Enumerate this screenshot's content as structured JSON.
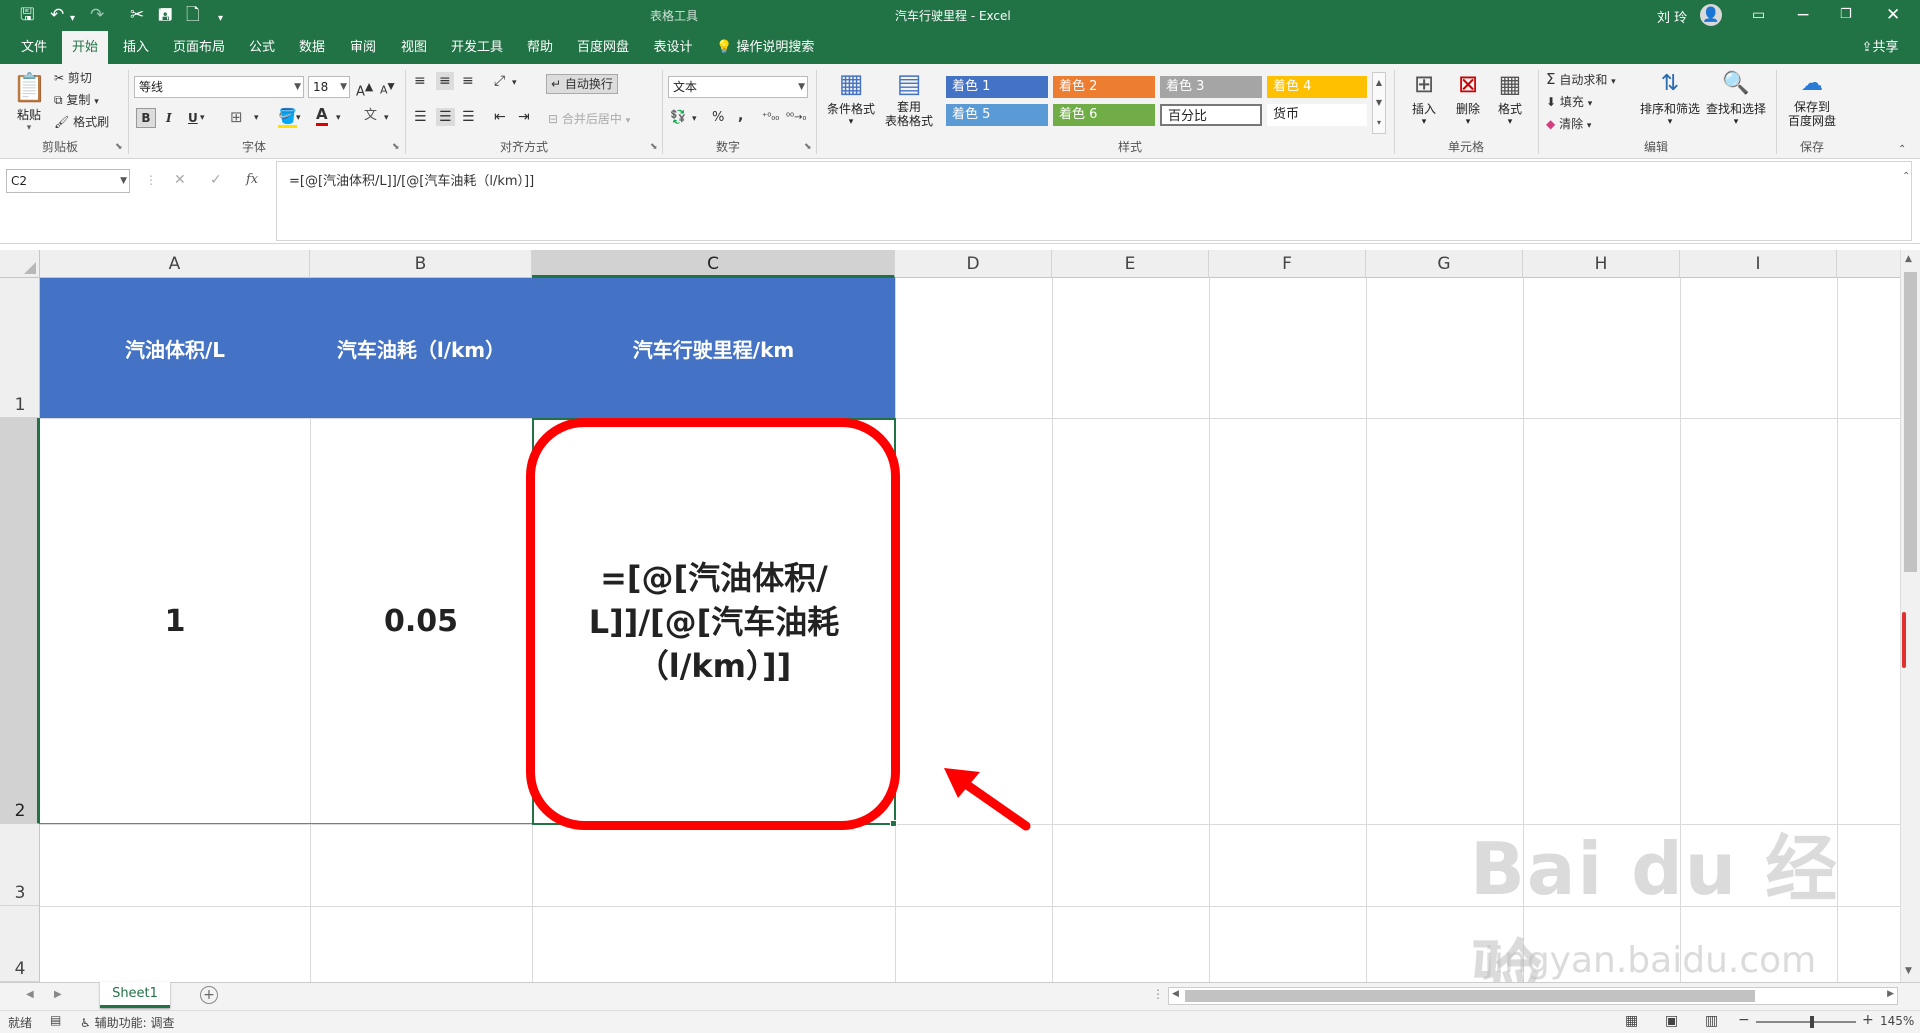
{
  "titlebar": {
    "context_tab": "表格工具",
    "title": "汽车行驶里程 - Excel",
    "user": "刘 玲",
    "qat_more": "▾"
  },
  "tabs": [
    "文件",
    "开始",
    "插入",
    "页面布局",
    "公式",
    "数据",
    "审阅",
    "视图",
    "开发工具",
    "帮助",
    "百度网盘",
    "表设计"
  ],
  "tell_me": "操作说明搜索",
  "share": "共享",
  "ribbon": {
    "clipboard": {
      "paste": "粘贴",
      "cut": "剪切",
      "copy": "复制",
      "painter": "格式刷",
      "label": "剪贴板"
    },
    "font": {
      "name": "等线",
      "size": "18",
      "bold": "B",
      "italic": "I",
      "underline": "U",
      "label": "字体"
    },
    "align": {
      "wrap": "自动换行",
      "merge": "合并后居中",
      "label": "对齐方式"
    },
    "number": {
      "format": "文本",
      "percent": "%",
      "comma": ",",
      "label": "数字"
    },
    "styles": {
      "cond": "条件格式",
      "table": "套用\n表格格式",
      "label": "样式",
      "items": [
        {
          "name": "着色 1",
          "color": "#4472c4"
        },
        {
          "name": "着色 2",
          "color": "#ed7d31"
        },
        {
          "name": "着色 3",
          "color": "#a5a5a5"
        },
        {
          "name": "着色 4",
          "color": "#ffc000"
        },
        {
          "name": "着色 5",
          "color": "#5b9bd5"
        },
        {
          "name": "着色 6",
          "color": "#70ad47"
        },
        {
          "name": "百分比",
          "color": "#ffffff"
        },
        {
          "name": "货币",
          "color": "#ffffff"
        }
      ]
    },
    "cells": {
      "insert": "插入",
      "delete": "删除",
      "format": "格式",
      "label": "单元格"
    },
    "editing": {
      "autosum": "自动求和",
      "fill": "填充",
      "clear": "清除",
      "sort": "排序和筛选",
      "find": "查找和选择",
      "label": "编辑"
    },
    "save": {
      "btn": "保存到\n百度网盘",
      "label": "保存"
    }
  },
  "formula_bar": {
    "name_box": "C2",
    "fx": "fx",
    "formula": "=[@[汽油体积/L]]/[@[汽车油耗（l/km）]]"
  },
  "columns": [
    "A",
    "B",
    "C",
    "D",
    "E",
    "F",
    "G",
    "H",
    "I"
  ],
  "rows": [
    "1",
    "2",
    "3",
    "4"
  ],
  "table": {
    "headers": [
      "汽油体积/L",
      "汽车油耗（l/km）",
      "汽车行驶里程/km"
    ],
    "row2": [
      "1",
      "0.05",
      "=[@[汽油体积/L]]/[@[汽车油耗（l/km）]]"
    ]
  },
  "sheet_tab": "Sheet1",
  "status": {
    "ready": "就绪",
    "accessibility": "辅助功能: 调查",
    "zoom": "145%"
  },
  "watermark": {
    "brand": "Bai du 经验",
    "url": "jingyan.baidu.com"
  },
  "colors": {
    "excel_green": "#217346",
    "table_header": "#4472c4",
    "highlight": "#ff0000"
  }
}
